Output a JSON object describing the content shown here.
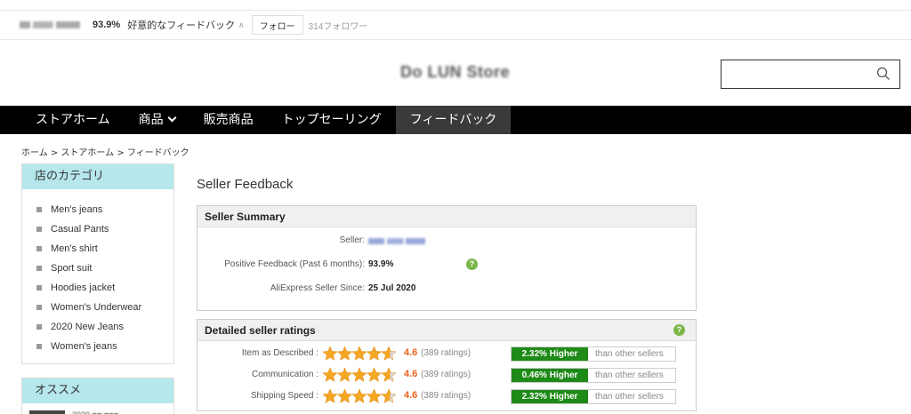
{
  "infobar": {
    "positive_pct": "93.9%",
    "positive_label": "好意的なフィードバック",
    "follow_label": "フォロー",
    "followers": "314フォロワー"
  },
  "header": {
    "search_placeholder": ""
  },
  "nav": {
    "items": [
      "ストアホーム",
      "商品",
      "販売商品",
      "トップセーリング",
      "フィードバック"
    ],
    "active_index": 4
  },
  "breadcrumb": "ホーム > ストアホーム > フィードバック",
  "sidebar": {
    "categories_title": "店のカテゴリ",
    "categories": [
      "Men's jeans",
      "Casual Pants",
      "Men's shirt",
      "Sport suit",
      "Hoodies jacket",
      "Women's Underwear",
      "2020 New Jeans",
      "Women's jeans"
    ],
    "recommend_title": "オススメ"
  },
  "main": {
    "title": "Seller Feedback",
    "summary": {
      "heading": "Seller Summary",
      "seller_label": "Seller:",
      "positive_label": "Positive Feedback (Past 6 months):",
      "positive_value": "93.9%",
      "since_label": "AliExpress Seller Since:",
      "since_value": "25 Jul 2020"
    },
    "ratings": {
      "heading": "Detailed seller ratings",
      "rows": [
        {
          "label": "Item as Described :",
          "score": "4.6",
          "stars": 4.6,
          "count": "(389 ratings)",
          "compare": "2.32% Higher",
          "compare_text": "than other sellers"
        },
        {
          "label": "Communication :",
          "score": "4.6",
          "stars": 4.6,
          "count": "(389 ratings)",
          "compare": "0.46% Higher",
          "compare_text": "than other sellers"
        },
        {
          "label": "Shipping Speed :",
          "score": "4.6",
          "stars": 4.6,
          "count": "(389 ratings)",
          "compare": "2.32% Higher",
          "compare_text": "than other sellers"
        }
      ]
    }
  },
  "colors": {
    "nav_bg": "#000000",
    "category_header": "#b5e7ec",
    "badge_green": "#1e8a17",
    "score_orange": "#e8621c",
    "star": "#f5a623"
  }
}
